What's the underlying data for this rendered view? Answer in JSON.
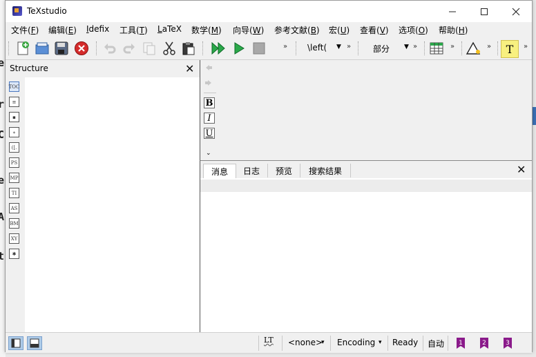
{
  "window": {
    "title": "TeXstudio",
    "minimize_icon": "minimize-icon",
    "maximize_icon": "maximize-icon",
    "close_icon": "close-icon"
  },
  "behind_chars": [
    "e",
    "r",
    "C",
    "e",
    "A",
    "t"
  ],
  "menu": [
    {
      "pre": "文件(",
      "key": "F",
      "post": ")"
    },
    {
      "pre": "编辑(",
      "key": "E",
      "post": ")"
    },
    {
      "pre": "",
      "key": "I",
      "post": "defix"
    },
    {
      "pre": "工具(",
      "key": "T",
      "post": ")"
    },
    {
      "pre": "",
      "key": "L",
      "post": "aTeX"
    },
    {
      "pre": "数学(",
      "key": "M",
      "post": ")"
    },
    {
      "pre": "向导(",
      "key": "W",
      "post": ")"
    },
    {
      "pre": "参考文献(",
      "key": "B",
      "post": ")"
    },
    {
      "pre": "宏(",
      "key": "U",
      "post": ")"
    },
    {
      "pre": "查看(",
      "key": "V",
      "post": ")"
    },
    {
      "pre": "选项(",
      "key": "O",
      "post": ")"
    },
    {
      "pre": "帮助(",
      "key": "H",
      "post": ")"
    }
  ],
  "toolbar": {
    "left_combo": "\\left(",
    "section_combo": "部分",
    "overflow": "»",
    "t_button": "T"
  },
  "structure": {
    "title": "Structure",
    "side_icons": [
      "TOC",
      "≡",
      "▪",
      "∗",
      "([.",
      "PS",
      "MP",
      "TI",
      "AS",
      "BM",
      "XY",
      "✱"
    ]
  },
  "format_buttons": [
    "B",
    "I",
    "U"
  ],
  "messages": {
    "tabs": [
      "消息",
      "日志",
      "预览",
      "搜索结果"
    ]
  },
  "status": {
    "lt": "LT",
    "dictionary": "<none>",
    "encoding": "Encoding",
    "state": "Ready",
    "mode": "自动",
    "bookmarks": [
      "1",
      "2",
      "3"
    ]
  }
}
